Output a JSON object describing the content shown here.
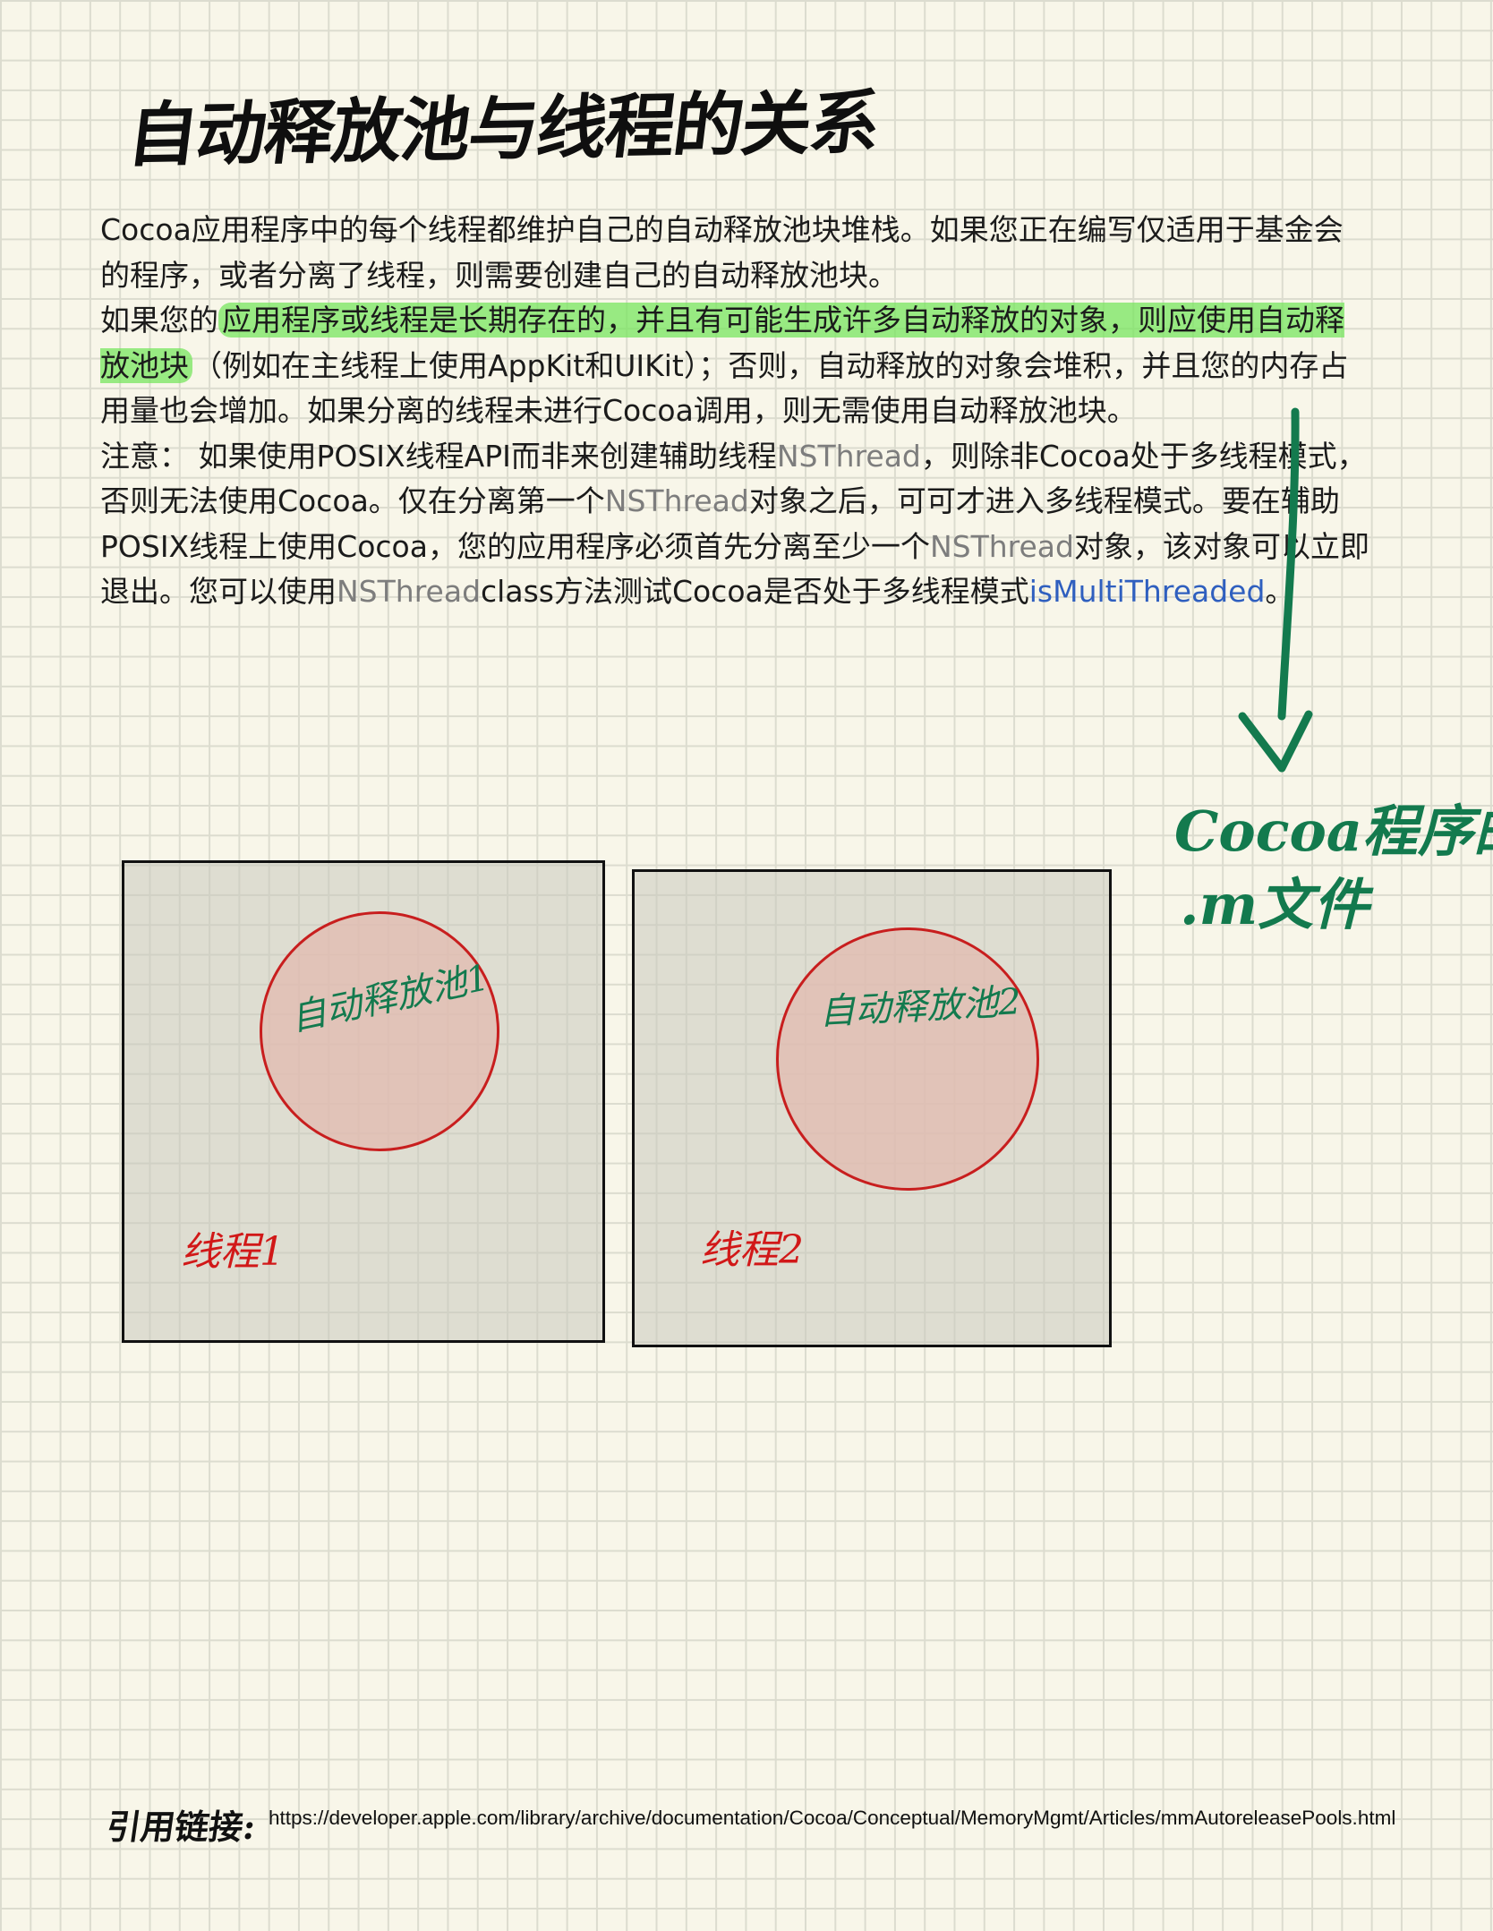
{
  "title": "自动释放池与线程的关系",
  "paragraph1": "Cocoa应用程序中的每个线程都维护自己的自动释放池块堆栈。如果您正在编写仅适用于基金会的程序，或者分离了线程，则需要创建自己的自动释放池块。",
  "paragraph2": {
    "pre": "如果您的",
    "highlight": "应用程序或线程是长期存在的，并且有可能生成许多自动释放的对象，则应使用自动释放池块",
    "post": "（例如在主线程上使用AppKit和UIKit）；否则，自动释放的对象会堆积，并且您的内存占用量也会增加。如果分离的线程未进行Cocoa调用，则无需使用自动释放池块。"
  },
  "paragraph3": {
    "part1": "注意： 如果使用POSIX线程API而非来创建辅助线程",
    "code1": "NSThread",
    "part2": "，则除非Cocoa处于多线程模式，否则无法使用Cocoa。仅在分离第一个",
    "code2": "NSThread",
    "part3": "对象之后，可可才进入多线程模式。要在辅助POSIX线程上使用Cocoa，您的应用程序必须首先分离至少一个",
    "code3": "NSThread",
    "part4": "对象，该对象可以立即退出。您可以使用",
    "code4": "NSThread",
    "part5": "class方法测试Cocoa是否处于多线程模式",
    "link": "isMultiThreaded",
    "part6": "。"
  },
  "annotation": {
    "line1": "Cocoa程序的",
    "line2": ".m文件"
  },
  "diagram": {
    "thread1": {
      "pool_label": "自动释放池1",
      "thread_label": "线程1"
    },
    "thread2": {
      "pool_label": "自动释放池2",
      "thread_label": "线程2"
    }
  },
  "footer": {
    "label": "引用链接:",
    "url": "https://developer.apple.com/library/archive/documentation/Cocoa/Conceptual/MemoryMgmt/Articles/mmAutoreleasePools.html"
  },
  "colors": {
    "ink_green": "#137a4e",
    "ink_red": "#d11818",
    "highlight": "#78e65f",
    "link": "#2f5fbf"
  }
}
